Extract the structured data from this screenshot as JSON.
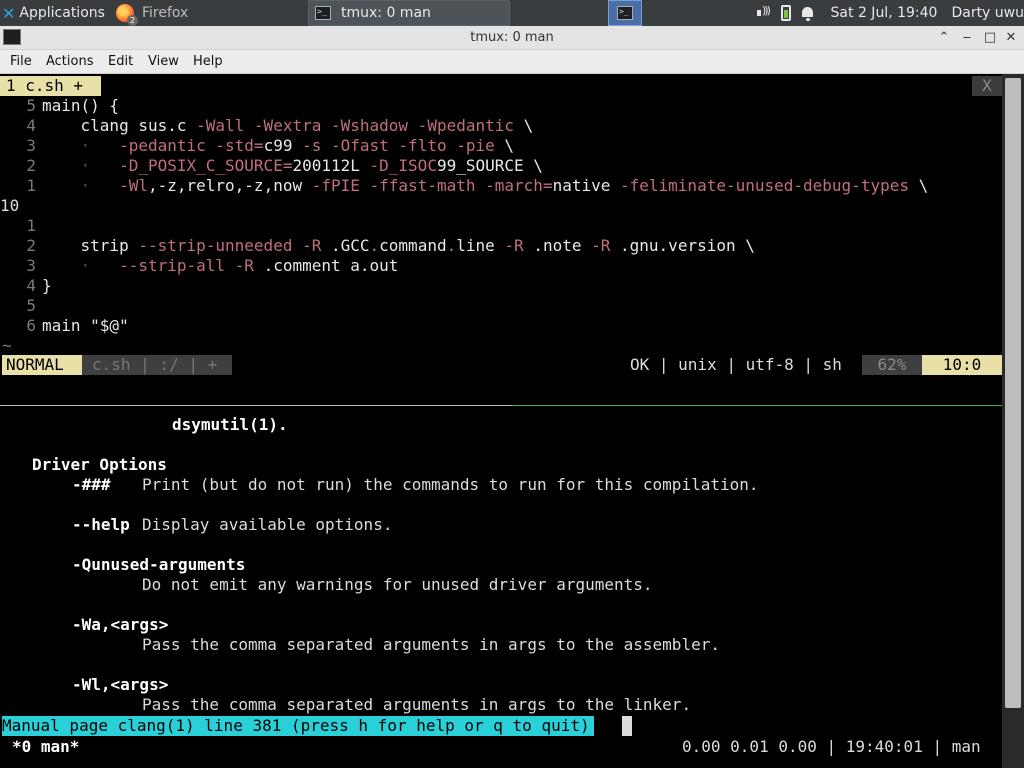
{
  "panel": {
    "applications_label": "Applications",
    "tasks": [
      {
        "label": "Firefox",
        "badge": "2"
      },
      {
        "label": "tmux: 0 man"
      }
    ],
    "clock": "Sat  2 Jul, 19:40",
    "user": "Darty uwu"
  },
  "window": {
    "title": "tmux: 0 man",
    "menu": [
      "File",
      "Actions",
      "Edit",
      "View",
      "Help"
    ]
  },
  "vim": {
    "tab_label": "1 c.sh +",
    "tab_close": "X",
    "lines": [
      {
        "num": "5",
        "indent": 0,
        "parts": [
          {
            "t": "main() {",
            "c": "wh"
          }
        ]
      },
      {
        "num": "4",
        "indent": 4,
        "parts": [
          {
            "t": "clang sus.c ",
            "c": "wh"
          },
          {
            "t": "-Wall -Wextra -Wshadow -Wpedantic",
            "c": "fl"
          },
          {
            "t": " \\",
            "c": "wh"
          }
        ]
      },
      {
        "num": "3",
        "indent": 4,
        "dots": true,
        "parts": [
          {
            "t": "-pedantic -std=",
            "c": "fl"
          },
          {
            "t": "c99 ",
            "c": "wh"
          },
          {
            "t": "-s -Ofast -flto -pie",
            "c": "fl"
          },
          {
            "t": " \\",
            "c": "wh"
          }
        ]
      },
      {
        "num": "2",
        "indent": 4,
        "dots": true,
        "parts": [
          {
            "t": "-D_POSIX_C_SOURCE=",
            "c": "fl"
          },
          {
            "t": "200112L ",
            "c": "wh"
          },
          {
            "t": "-D_ISOC",
            "c": "fl"
          },
          {
            "t": "99_SOURCE \\",
            "c": "wh"
          }
        ]
      },
      {
        "num": "1",
        "indent": 4,
        "dots": true,
        "parts": [
          {
            "t": "-Wl",
            "c": "fl"
          },
          {
            "t": ",-z,relro,-z,now ",
            "c": "wh"
          },
          {
            "t": "-fPIE -ffast-math -march=",
            "c": "fl"
          },
          {
            "t": "native ",
            "c": "wh"
          },
          {
            "t": "-feliminate-unused-debug-types",
            "c": "fl"
          },
          {
            "t": " \\",
            "c": "wh"
          }
        ]
      },
      {
        "num": "10",
        "current": true,
        "indent": 0,
        "parts": []
      },
      {
        "num": "1",
        "indent": 0,
        "parts": []
      },
      {
        "num": "2",
        "indent": 4,
        "parts": [
          {
            "t": "strip ",
            "c": "wh"
          },
          {
            "t": "--strip-unneeded -R ",
            "c": "fl"
          },
          {
            "t": ".GCC",
            "c": "wh"
          },
          {
            "t": ".",
            "c": "fl"
          },
          {
            "t": "command",
            "c": "wh"
          },
          {
            "t": ".",
            "c": "fl"
          },
          {
            "t": "line ",
            "c": "wh"
          },
          {
            "t": "-R ",
            "c": "fl"
          },
          {
            "t": ".note ",
            "c": "wh"
          },
          {
            "t": "-R ",
            "c": "fl"
          },
          {
            "t": ".gnu.version \\",
            "c": "wh"
          }
        ]
      },
      {
        "num": "3",
        "indent": 4,
        "dots": true,
        "parts": [
          {
            "t": "--strip-all -R ",
            "c": "fl"
          },
          {
            "t": ".comment a.out",
            "c": "wh"
          }
        ]
      },
      {
        "num": "4",
        "indent": 0,
        "parts": [
          {
            "t": "}",
            "c": "wh"
          }
        ]
      },
      {
        "num": "5",
        "indent": 0,
        "parts": []
      },
      {
        "num": "6",
        "indent": 0,
        "parts": [
          {
            "t": "main \"$@\"",
            "c": "wh"
          }
        ]
      }
    ],
    "tilde": "~",
    "status": {
      "mode": "NORMAL",
      "file": "c.sh | :/ | +",
      "right": "OK | unix | utf-8 | sh",
      "percent": "62%",
      "position": "10:0"
    }
  },
  "man": {
    "lines": [
      {
        "text": "dsymutil(1).",
        "indent": 17,
        "style": "bold",
        "trail": ""
      },
      {
        "text": "",
        "indent": 0
      },
      {
        "text": "Driver Options",
        "indent": 3,
        "style": "bold"
      },
      {
        "text": "-###",
        "indent": 7,
        "style": "bold",
        "desc": "Print (but do not run) the commands to run for this compilation.",
        "desc_col": 14
      },
      {
        "text": "",
        "indent": 0
      },
      {
        "text": "--help",
        "indent": 7,
        "style": "bold",
        "desc": "Display available options.",
        "desc_col": 14
      },
      {
        "text": "",
        "indent": 0
      },
      {
        "text": "-Qunused-arguments",
        "indent": 7,
        "style": "bold"
      },
      {
        "text": "Do not emit any warnings for unused driver arguments.",
        "indent": 14,
        "style": "plain"
      },
      {
        "text": "",
        "indent": 0
      },
      {
        "text": "-Wa,<args>",
        "indent": 7,
        "style": "bold"
      },
      {
        "text": "Pass the comma separated arguments in args to the assembler.",
        "indent": 14,
        "style": "plain"
      },
      {
        "text": "",
        "indent": 0
      },
      {
        "text": "-Wl,<args>",
        "indent": 7,
        "style": "bold"
      },
      {
        "text": "Pass the comma separated arguments in args to the linker.",
        "indent": 14,
        "style": "plain"
      }
    ],
    "status": "Manual page clang(1) line 381 (press h for help or q to quit)"
  },
  "tmux": {
    "window": "*0 man*",
    "right": "0.00 0.01 0.00 | 19:40:01 | man"
  },
  "colors": {
    "flag": "#c06e7e",
    "vim_accent": "#e9e0a8",
    "man_status": "#29d0d8",
    "pane_divider_active": "#4caf50"
  }
}
